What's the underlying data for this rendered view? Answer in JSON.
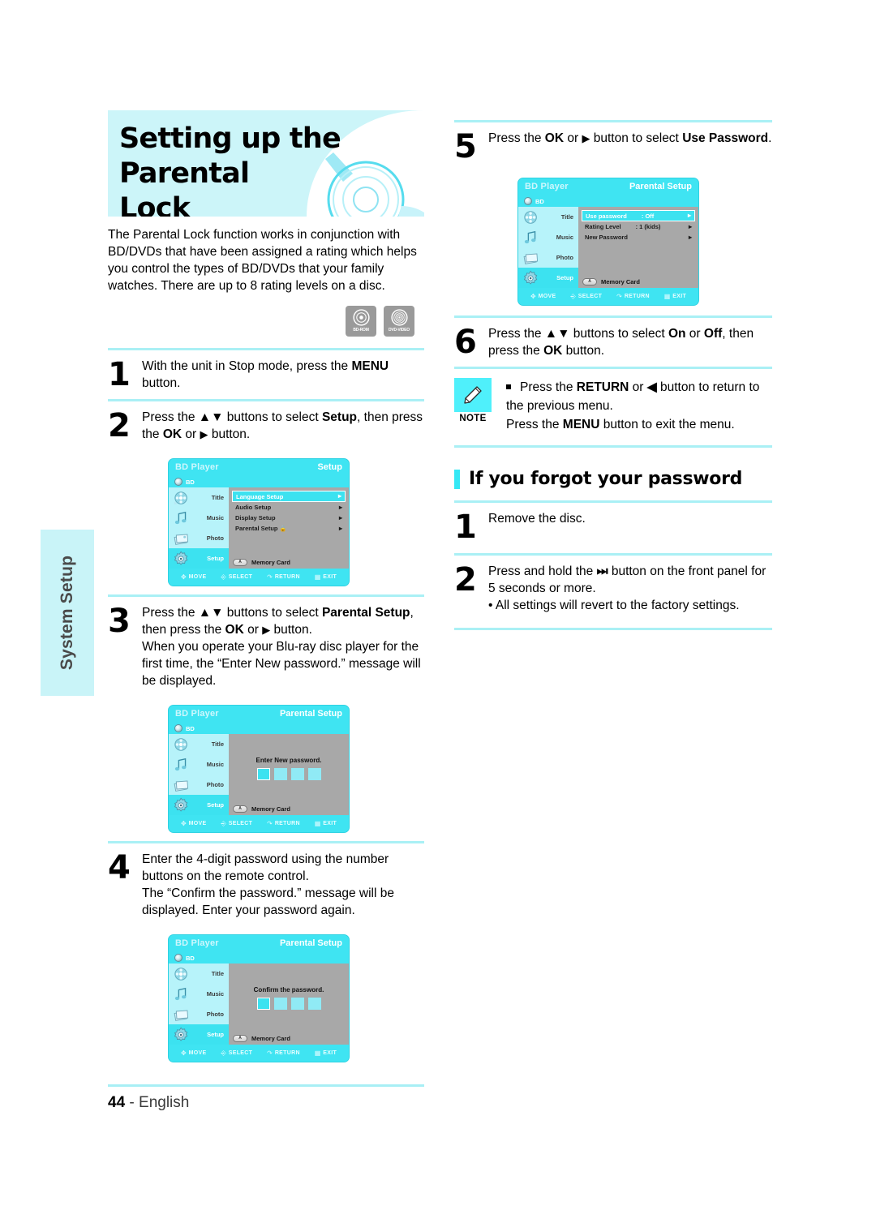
{
  "side_tab": {
    "label": "System Setup"
  },
  "banner": {
    "title_line1": "Setting up the Parental",
    "title_line2": "Lock"
  },
  "intro": "The Parental Lock function works in conjunction with BD/DVDs that have been assigned a rating which helps you control the types of BD/DVDs that your family watches. There are up to 8 rating levels on a disc.",
  "disc_logos": [
    {
      "name": "bd-rom-logo",
      "caption": "BD-ROM"
    },
    {
      "name": "dvd-video-logo",
      "caption": "DVD-VIDEO"
    }
  ],
  "steps_left": [
    {
      "num": "1",
      "text_html": "With the unit in Stop mode, press the <b>MENU</b> button."
    },
    {
      "num": "2",
      "text_html": "Press the <b>▲▼</b> buttons to select <b>Setup</b>, then press the <b>OK</b> or <span class=\"tri\">▶</span> button."
    },
    {
      "num": "3",
      "text_html": "Press the <b>▲▼</b> buttons to select <b>Parental Setup</b>, then press the <b>OK</b> or <span class=\"tri\">▶</span> button.<br>When you operate your Blu-ray disc player for the first time, the “Enter New password.” message will be displayed."
    },
    {
      "num": "4",
      "text_html": "Enter the 4-digit password using the number buttons on the remote control.<br>The “Confirm the password.” message will be displayed. Enter your password again."
    }
  ],
  "steps_right": [
    {
      "num": "5",
      "text_html": "Press the <b>OK</b> or <span class=\"tri\">▶</span> button to select <b>Use Password</b>."
    },
    {
      "num": "6",
      "text_html": "Press the <b>▲▼</b> buttons to select <b>On</b> or <b>Off</b>, then press the <b>OK</b> button."
    }
  ],
  "note": {
    "word": "NOTE",
    "text_html": "Press the <b>RETURN</b> or <b>◀</b> button to return to the previous menu.<br>Press the <b>MENU</b> button to exit the menu."
  },
  "section": {
    "title": "If you forgot your password"
  },
  "steps_forgot": [
    {
      "num": "1",
      "text_html": "Remove the disc."
    },
    {
      "num": "2",
      "text_html": "Press and hold the <b>⏭</b> button on the front panel for 5 seconds or more.<br><span class=\"sub-bullet\">• All settings will revert to the factory settings.</span>"
    }
  ],
  "footer": {
    "page_number": "44",
    "sep": "-",
    "language": "English"
  },
  "tv_common": {
    "brand": "BD Player",
    "source_label": "BD",
    "side_items": [
      {
        "name": "title",
        "label": "Title"
      },
      {
        "name": "music",
        "label": "Music"
      },
      {
        "name": "photo",
        "label": "Photo"
      },
      {
        "name": "setup",
        "label": "Setup"
      }
    ],
    "memory_card": "Memory Card",
    "memory_card_key": "A",
    "bottom_bar": [
      {
        "icon": "dpad-icon",
        "label": "MOVE"
      },
      {
        "icon": "enter-icon",
        "label": "SELECT"
      },
      {
        "icon": "return-icon",
        "label": "RETURN"
      },
      {
        "icon": "exit-icon",
        "label": "EXIT"
      }
    ]
  },
  "tv_setup": {
    "screen_title": "Setup",
    "rows": [
      {
        "label": "Language Setup",
        "value": "",
        "selected": true,
        "lock": false
      },
      {
        "label": "Audio Setup",
        "value": "",
        "selected": false,
        "lock": false
      },
      {
        "label": "Display Setup",
        "value": "",
        "selected": false,
        "lock": false
      },
      {
        "label": "Parental Setup",
        "value": "",
        "selected": false,
        "lock": true
      }
    ]
  },
  "tv_enter_pw": {
    "screen_title": "Parental Setup",
    "message": "Enter New password.",
    "box_count": 4
  },
  "tv_confirm_pw": {
    "screen_title": "Parental Setup",
    "message": "Confirm the password.",
    "box_count": 4
  },
  "tv_parental": {
    "screen_title": "Parental Setup",
    "rows": [
      {
        "label": "Use password",
        "value": ": Off",
        "selected": true,
        "lock": false
      },
      {
        "label": "Rating Level",
        "value": ": 1 (kids)",
        "selected": false,
        "lock": false
      },
      {
        "label": "New Password",
        "value": "",
        "selected": false,
        "lock": false
      }
    ]
  },
  "colors": {
    "banner_bg": "#ccf5f9",
    "tab_bg": "#c9f4f8",
    "rule": "#aaf0f5",
    "accent": "#35e8f5",
    "osd_cyan": "#3fe4f2",
    "osd_panel": "#a8a8a8",
    "note_bg": "#4ff0fb"
  }
}
